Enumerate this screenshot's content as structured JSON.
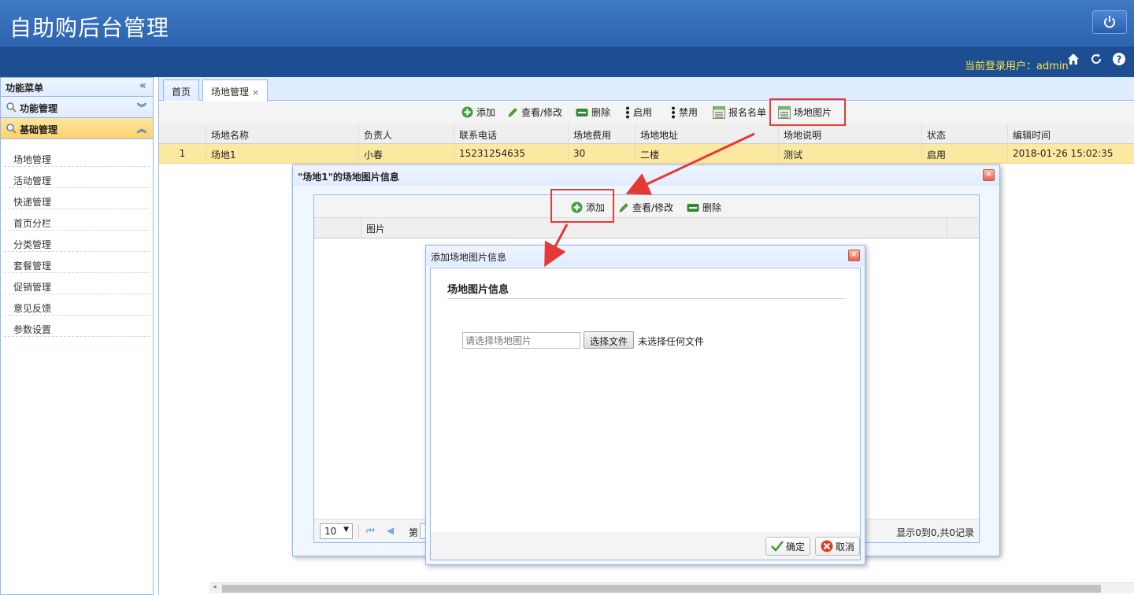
{
  "header": {
    "title": "自助购后台管理",
    "user_label": "当前登录用户：admin"
  },
  "sidebar": {
    "title": "功能菜单",
    "panels": [
      {
        "label": "功能管理"
      },
      {
        "label": "基础管理"
      }
    ],
    "items": [
      "场地管理",
      "活动管理",
      "快递管理",
      "首页分栏",
      "分类管理",
      "套餐管理",
      "促销管理",
      "意见反馈",
      "参数设置"
    ]
  },
  "tabs": [
    {
      "label": "首页"
    },
    {
      "label": "场地管理"
    }
  ],
  "toolbar": {
    "add": "添加",
    "view_edit": "查看/修改",
    "delete": "删除",
    "enable": "启用",
    "disable": "禁用",
    "signup_list": "报名名单",
    "site_image": "场地图片"
  },
  "grid": {
    "columns": [
      "场地名称",
      "负责人",
      "联系电话",
      "场地费用",
      "场地地址",
      "场地说明",
      "状态",
      "编辑时间"
    ],
    "rows": [
      {
        "num": "1",
        "name": "场地1",
        "owner": "小春",
        "phone": "15231254635",
        "fee": "30",
        "address": "二楼",
        "desc": "测试",
        "status": "启用",
        "time": "2018-01-26 15:02:35"
      }
    ]
  },
  "dialog1": {
    "title": "\"场地1\"的场地图片信息",
    "toolbar": {
      "add": "添加",
      "view_edit": "查看/修改",
      "delete": "删除"
    },
    "column": "图片",
    "pager": {
      "page_size": "10",
      "page_prefix": "第",
      "summary": "显示0到0,共0记录"
    }
  },
  "dialog2": {
    "title": "添加场地图片信息",
    "section": "场地图片信息",
    "file_placeholder": "请选择场地图片",
    "choose_button": "选择文件",
    "no_file": "未选择任何文件",
    "ok": "确定",
    "cancel": "取消"
  },
  "colors": {
    "accent": "#1f56a3",
    "selected_row": "#fbe9a1",
    "highlight": "#e53935"
  }
}
